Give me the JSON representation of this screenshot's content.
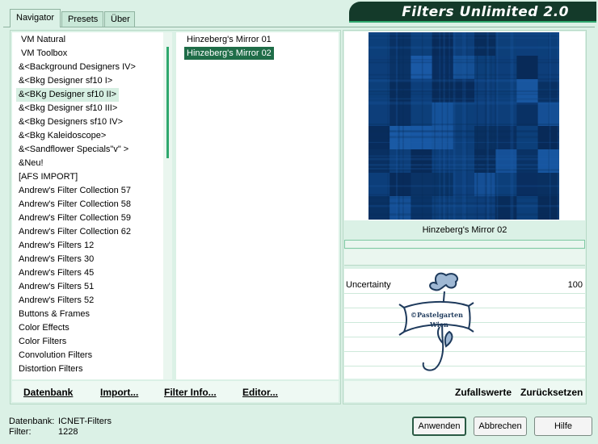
{
  "app": {
    "title": "Filters Unlimited 2.0"
  },
  "tabs": [
    {
      "label": "Navigator",
      "active": true
    },
    {
      "label": "Presets",
      "active": false
    },
    {
      "label": "Über",
      "active": false
    }
  ],
  "categories": [
    "VM Natural",
    "VM Toolbox",
    "&<Background Designers IV>",
    "&<Bkg Designer sf10 I>",
    "&<BKg Designer sf10 II>",
    "&<Bkg Designer sf10 III>",
    "&<Bkg Designers sf10 IV>",
    "&<Bkg Kaleidoscope>",
    "&<Sandflower Specials\"v\" >",
    "&Neu!",
    "[AFS IMPORT]",
    "Andrew's Filter Collection 57",
    "Andrew's Filter Collection 58",
    "Andrew's Filter Collection 59",
    "Andrew's Filter Collection 62",
    "Andrew's Filters 12",
    "Andrew's Filters 30",
    "Andrew's Filters 45",
    "Andrew's Filters 51",
    "Andrew's Filters 52",
    "Buttons & Frames",
    "Color Effects",
    "Color Filters",
    "Convolution Filters",
    "Distortion Filters"
  ],
  "selected_category": "&<BKg Designer sf10 II>",
  "filters": [
    "Hinzeberg's Mirror 01",
    "Hinzeberg's Mirror 02"
  ],
  "selected_filter": "Hinzeberg's Mirror 02",
  "preview": {
    "filter_name": "Hinzeberg's Mirror 02",
    "colors": {
      "base": "#0d3f7a",
      "dark": "#082a58",
      "light": "#1a5aa6"
    }
  },
  "params": [
    {
      "label": "Uncertainty",
      "value": "100"
    }
  ],
  "watermark": {
    "text_line1": "©Pastelgarten",
    "text_line2": "Wien"
  },
  "left_links": {
    "database": "Datenbank",
    "import": "Import...",
    "filter_info": "Filter Info...",
    "editor": "Editor..."
  },
  "right_links": {
    "random": "Zufallswerte",
    "reset": "Zurücksetzen"
  },
  "status": {
    "database_label": "Datenbank:",
    "database_value": "ICNET-Filters",
    "filter_label": "Filter:",
    "filter_value": "1228"
  },
  "buttons": {
    "apply": "Anwenden",
    "cancel": "Abbrechen",
    "help": "Hilfe"
  },
  "colors": {
    "accent": "#1f6d48",
    "background": "#dbf1e6",
    "banner": "#143a2a"
  }
}
